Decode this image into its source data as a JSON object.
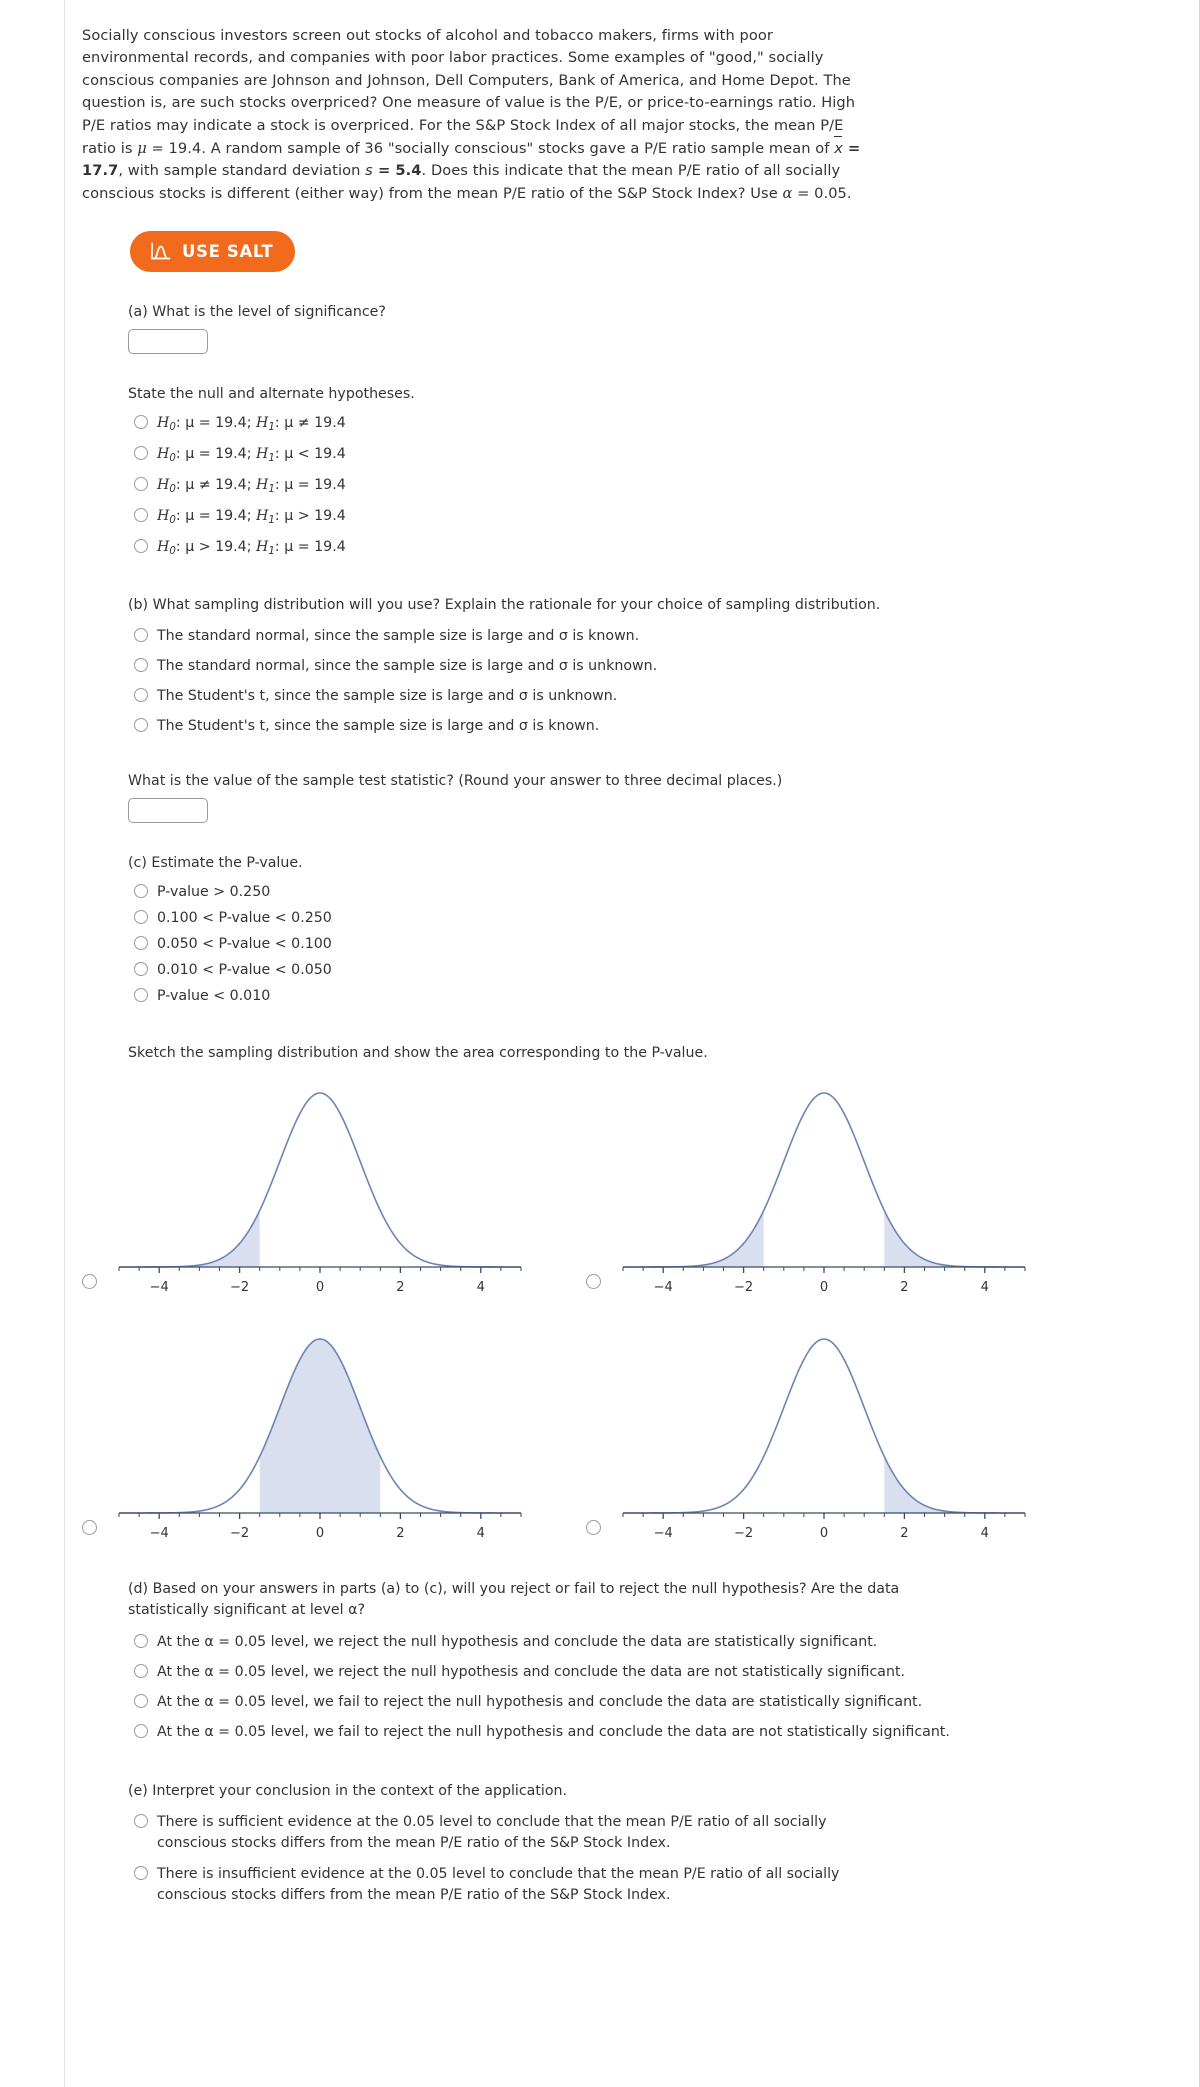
{
  "colors": {
    "salt_orange": "#f26a1b",
    "curve_blue": "#6b85b5",
    "shade_blue": "#d9dfee",
    "text": "#333333"
  },
  "intro": {
    "p1_a": "Socially conscious investors screen out stocks of alcohol and tobacco makers, firms with poor environmental records, and companies with poor labor practices. Some examples of \"good,\" socially conscious companies are Johnson and Johnson, Dell Computers, Bank of America, and Home Depot. The question is, are such stocks overpriced? One measure of value is the P/E, or price-to-earnings ratio. High P/E ratios may indicate a stock is overpriced. For the S&P Stock Index of all major stocks, the mean P/E ratio is ",
    "mu_symbol": "μ",
    "mu_value": " = 19.4. A random sample of 36 \"socially conscious\" stocks gave a P/E ratio sample mean of ",
    "xbar_symbol": "x",
    "xbar_value": " = 17.7",
    "p1_b": ", with sample standard deviation ",
    "s_symbol": "s",
    "s_value": " = 5.4",
    "p1_c": ". Does this indicate that the mean P/E ratio of all socially conscious stocks is different (either way) from the mean P/E ratio of the S&P Stock Index? Use ",
    "alpha_symbol": "α",
    "alpha_value": " = 0.05."
  },
  "salt_button": {
    "label": "USE SALT",
    "icon": "distribution-curve-icon"
  },
  "part_a": {
    "question": "(a) What is the level of significance?",
    "input_value": "",
    "input_placeholder": ""
  },
  "hypotheses": {
    "prompt": "State the null and alternate hypotheses.",
    "options": [
      {
        "h0_sub": "0",
        "h0": "μ = 19.4;",
        "h1_sub": "1",
        "h1": "μ ≠ 19.4"
      },
      {
        "h0_sub": "0",
        "h0": "μ = 19.4;",
        "h1_sub": "1",
        "h1": "μ < 19.4"
      },
      {
        "h0_sub": "0",
        "h0": "μ ≠ 19.4;",
        "h1_sub": "1",
        "h1": "μ = 19.4"
      },
      {
        "h0_sub": "0",
        "h0": "μ = 19.4;",
        "h1_sub": "1",
        "h1": "μ > 19.4"
      },
      {
        "h0_sub": "0",
        "h0": "μ > 19.4;",
        "h1_sub": "1",
        "h1": "μ = 19.4"
      }
    ]
  },
  "part_b": {
    "question": "(b) What sampling distribution will you use? Explain the rationale for your choice of sampling distribution.",
    "options": [
      "The standard normal, since the sample size is large and σ is known.",
      "The standard normal, since the sample size is large and σ is unknown.",
      "The Student's t, since the sample size is large and σ is unknown.",
      "The Student's t, since the sample size is large and σ is known."
    ]
  },
  "test_statistic": {
    "question": "What is the value of the sample test statistic? (Round your answer to three decimal places.)",
    "input_value": "",
    "input_placeholder": ""
  },
  "part_c": {
    "question": "(c) Estimate the P-value.",
    "options": [
      "P-value > 0.250",
      "0.100 < P-value < 0.250",
      "0.050 < P-value < 0.100",
      "0.010 < P-value < 0.050",
      "P-value < 0.010"
    ]
  },
  "sketch": {
    "prompt": "Sketch the sampling distribution and show the area corresponding to the P-value."
  },
  "chart_data": [
    {
      "id": "graph-top-left",
      "type": "area",
      "title": "",
      "xlabel": "",
      "ylabel": "",
      "xlim": [
        -5,
        5
      ],
      "tick_labels": [
        "-4",
        "-2",
        "0",
        "2",
        "4"
      ],
      "tick_values": [
        -4,
        -2,
        0,
        2,
        4
      ],
      "distribution": "standard normal",
      "shaded_regions": [
        {
          "from": -5,
          "to": -1.5
        }
      ],
      "shade_description": "left tail shaded from -infinity to about -1.5",
      "curve_color": "#6b85b5",
      "shade_color": "#d9dfee",
      "grid": false,
      "legend": "none"
    },
    {
      "id": "graph-top-right",
      "type": "area",
      "title": "",
      "xlabel": "",
      "ylabel": "",
      "xlim": [
        -5,
        5
      ],
      "tick_labels": [
        "-4",
        "-2",
        "0",
        "2",
        "4"
      ],
      "tick_values": [
        -4,
        -2,
        0,
        2,
        4
      ],
      "distribution": "standard normal",
      "shaded_regions": [
        {
          "from": -5,
          "to": -1.5
        },
        {
          "from": 1.5,
          "to": 5
        }
      ],
      "shade_description": "both tails shaded beyond about -1.5 and +1.5",
      "curve_color": "#6b85b5",
      "shade_color": "#d9dfee",
      "grid": false,
      "legend": "none"
    },
    {
      "id": "graph-bottom-left",
      "type": "area",
      "title": "",
      "xlabel": "",
      "ylabel": "",
      "xlim": [
        -5,
        5
      ],
      "tick_labels": [
        "-4",
        "-2",
        "0",
        "2",
        "4"
      ],
      "tick_values": [
        -4,
        -2,
        0,
        2,
        4
      ],
      "distribution": "standard normal",
      "shaded_regions": [
        {
          "from": -1.5,
          "to": 1.5
        }
      ],
      "shade_description": "central region shaded between about -1.5 and +1.5",
      "curve_color": "#6b85b5",
      "shade_color": "#d9dfee",
      "grid": false,
      "legend": "none"
    },
    {
      "id": "graph-bottom-right",
      "type": "area",
      "title": "",
      "xlabel": "",
      "ylabel": "",
      "xlim": [
        -5,
        5
      ],
      "tick_labels": [
        "-4",
        "-2",
        "0",
        "2",
        "4"
      ],
      "tick_values": [
        -4,
        -2,
        0,
        2,
        4
      ],
      "distribution": "standard normal",
      "shaded_regions": [
        {
          "from": 1.5,
          "to": 5
        }
      ],
      "shade_description": "right tail shaded from about +1.5 to +infinity",
      "curve_color": "#6b85b5",
      "shade_color": "#d9dfee",
      "grid": false,
      "legend": "none"
    }
  ],
  "part_d": {
    "question": "(d) Based on your answers in parts (a) to (c), will you reject or fail to reject the null hypothesis? Are the data statistically significant at level α?",
    "options": [
      "At the α = 0.05 level, we reject the null hypothesis and conclude the data are statistically significant.",
      "At the α = 0.05 level, we reject the null hypothesis and conclude the data are not statistically significant.",
      "At the α = 0.05 level, we fail to reject the null hypothesis and conclude the data are statistically significant.",
      "At the α = 0.05 level, we fail to reject the null hypothesis and conclude the data are not statistically significant."
    ]
  },
  "part_e": {
    "question": "(e) Interpret your conclusion in the context of the application.",
    "options": [
      "There is sufficient evidence at the 0.05 level to conclude that the mean P/E ratio of all socially conscious stocks differs from the mean P/E ratio of the S&P Stock Index.",
      "There is insufficient evidence at the 0.05 level to conclude that the mean P/E ratio of all socially conscious stocks differs from the mean P/E ratio of the S&P Stock Index."
    ]
  }
}
